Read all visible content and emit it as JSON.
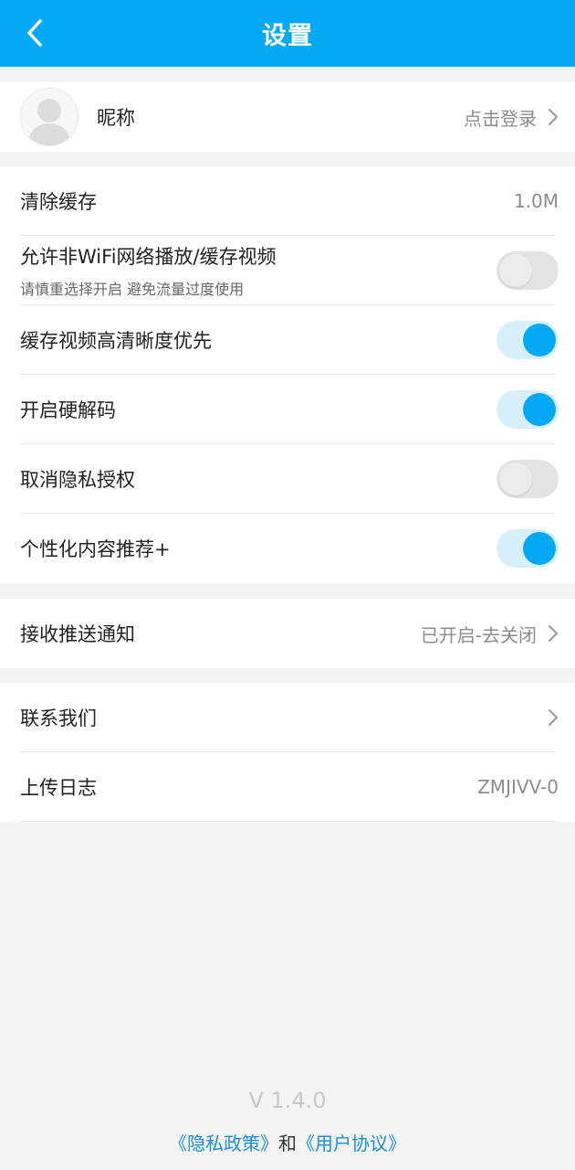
{
  "header": {
    "title": "设置"
  },
  "profile": {
    "nickname": "昵称",
    "login_text": "点击登录"
  },
  "settings": {
    "clear_cache": {
      "label": "清除缓存",
      "value": "1.0M"
    },
    "allow_non_wifi": {
      "label": "允许非WiFi网络播放/缓存视频",
      "sublabel": "请慎重选择开启 避免流量过度使用",
      "enabled": false
    },
    "hd_cache": {
      "label": "缓存视频高清晰度优先",
      "enabled": true
    },
    "hw_decode": {
      "label": "开启硬解码",
      "enabled": true
    },
    "revoke_privacy": {
      "label": "取消隐私授权",
      "enabled": false
    },
    "personalized": {
      "label": "个性化内容推荐+",
      "enabled": true
    }
  },
  "push": {
    "label": "接收推送通知",
    "value": "已开启-去关闭"
  },
  "contact": {
    "label": "联系我们"
  },
  "upload_log": {
    "label": "上传日志",
    "value": "ZMJIVV-0"
  },
  "footer": {
    "version": "V 1.4.0",
    "privacy_link": "《隐私政策》",
    "and_text": "和",
    "agreement_link": "《用户协议》"
  },
  "colors": {
    "primary": "#03a9f4",
    "background": "#f3f3f3"
  }
}
